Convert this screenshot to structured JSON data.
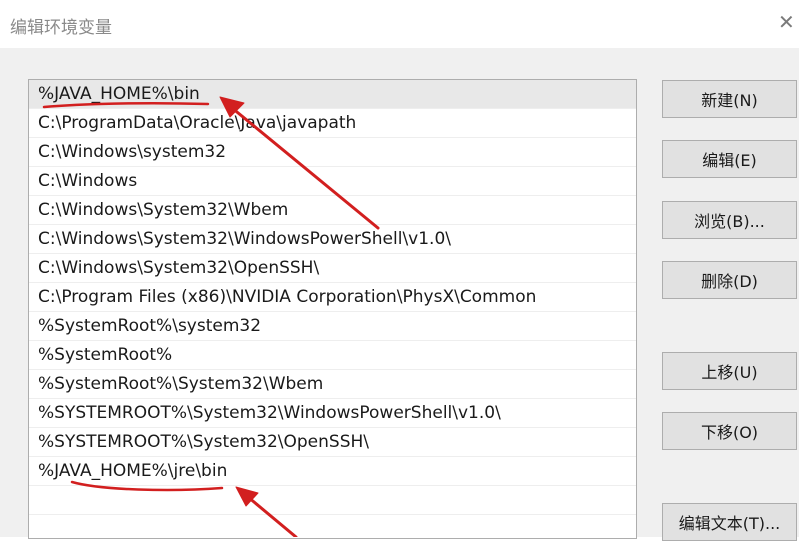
{
  "window": {
    "title": "编辑环境变量",
    "close_glyph": "✕"
  },
  "path_entries": [
    "%JAVA_HOME%\\bin",
    "C:\\ProgramData\\Oracle\\Java\\javapath",
    "C:\\Windows\\system32",
    "C:\\Windows",
    "C:\\Windows\\System32\\Wbem",
    "C:\\Windows\\System32\\WindowsPowerShell\\v1.0\\",
    "C:\\Windows\\System32\\OpenSSH\\",
    "C:\\Program Files (x86)\\NVIDIA Corporation\\PhysX\\Common",
    "%SystemRoot%\\system32",
    "%SystemRoot%",
    "%SystemRoot%\\System32\\Wbem",
    "%SYSTEMROOT%\\System32\\WindowsPowerShell\\v1.0\\",
    "%SYSTEMROOT%\\System32\\OpenSSH\\",
    "%JAVA_HOME%\\jre\\bin",
    ""
  ],
  "buttons": {
    "new": "新建(N)",
    "edit": "编辑(E)",
    "browse": "浏览(B)...",
    "delete": "删除(D)",
    "move_up": "上移(U)",
    "move_down": "下移(O)",
    "edit_text": "编辑文本(T)..."
  },
  "colors": {
    "annotation": "#d21f1f",
    "button_face": "#e1e1e1",
    "dialog_bg": "#f0f0f0"
  }
}
